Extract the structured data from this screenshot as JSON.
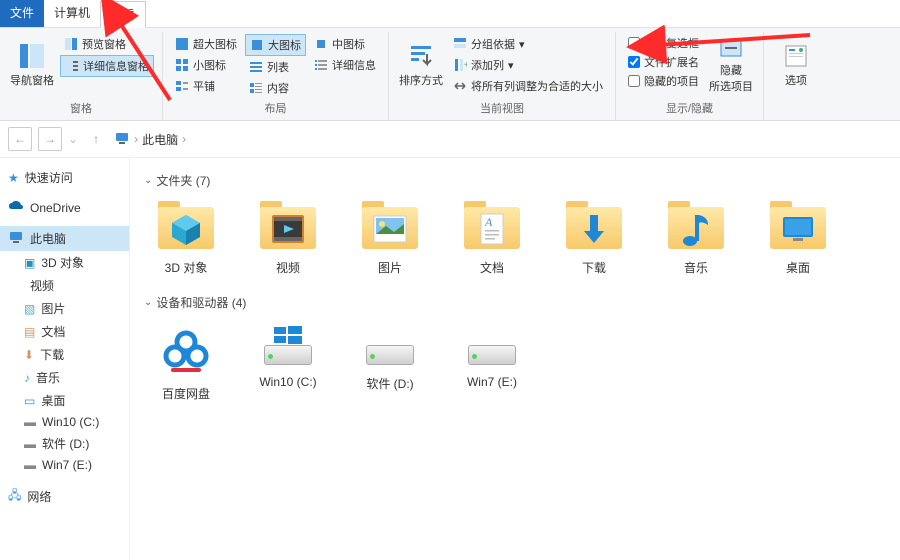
{
  "tabs": {
    "file": "文件",
    "computer": "计算机",
    "view": "查看"
  },
  "ribbon": {
    "panes": {
      "nav_pane": "导航窗格",
      "preview_pane": "预览窗格",
      "details_pane": "详细信息窗格",
      "label": "窗格"
    },
    "layout": {
      "extra_large": "超大图标",
      "large": "大图标",
      "medium": "中图标",
      "small": "小图标",
      "list": "列表",
      "details": "详细信息",
      "tiles": "平铺",
      "content": "内容",
      "label": "布局"
    },
    "current_view": {
      "sort": "排序方式",
      "group_by": "分组依据",
      "add_column": "添加列",
      "size_all": "将所有列调整为合适的大小",
      "label": "当前视图"
    },
    "show_hide": {
      "item_check": "项目复选框",
      "file_ext": "文件扩展名",
      "hidden_items": "隐藏的项目",
      "hide_selected": "隐藏\n所选项目",
      "label": "显示/隐藏"
    },
    "options": {
      "btn": "选项"
    }
  },
  "breadcrumb": {
    "root": "此电脑"
  },
  "sidebar": {
    "quick_access": "快速访问",
    "onedrive": "OneDrive",
    "this_pc": "此电脑",
    "three_d": "3D 对象",
    "videos": "视频",
    "pictures": "图片",
    "documents": "文档",
    "downloads": "下载",
    "music": "音乐",
    "desktop": "桌面",
    "win10": "Win10 (C:)",
    "soft": "软件 (D:)",
    "win7": "Win7 (E:)",
    "network": "网络"
  },
  "sections": {
    "folders": {
      "title": "文件夹 (7)"
    },
    "devices": {
      "title": "设备和驱动器 (4)"
    }
  },
  "folders": [
    {
      "label": "3D 对象"
    },
    {
      "label": "视频"
    },
    {
      "label": "图片"
    },
    {
      "label": "文档"
    },
    {
      "label": "下载"
    },
    {
      "label": "音乐"
    },
    {
      "label": "桌面"
    }
  ],
  "drives": [
    {
      "label": "百度网盘"
    },
    {
      "label": "Win10 (C:)"
    },
    {
      "label": "软件 (D:)"
    },
    {
      "label": "Win7 (E:)"
    }
  ]
}
